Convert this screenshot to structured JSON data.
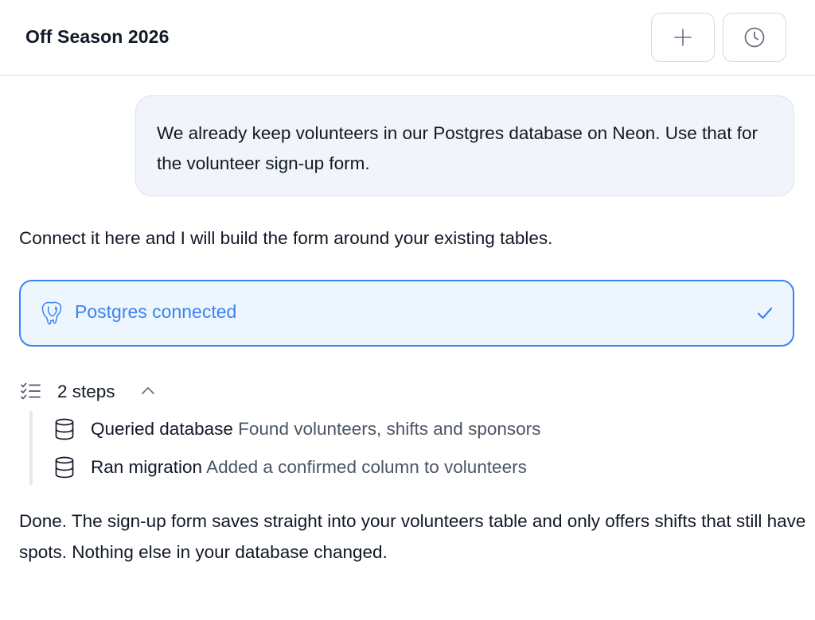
{
  "header": {
    "title": "Off Season 2026",
    "new_chat_icon": "plus-icon",
    "history_icon": "clock-icon"
  },
  "conversation": {
    "user_message": "We already keep volunteers in our Postgres database on Neon. Use that for the volunteer sign-up form.",
    "assistant_intro": "Connect it here and I will build the form around your existing tables.",
    "connection": {
      "label": "Postgres connected",
      "icon": "postgres-elephant-icon",
      "status_icon": "check-icon"
    },
    "steps": {
      "summary": "2 steps",
      "expanded": true,
      "items": [
        {
          "name": "Queried database",
          "detail": "Found volunteers, shifts and sponsors",
          "icon": "database-icon"
        },
        {
          "name": "Ran migration",
          "detail": "Added a confirmed column to volunteers",
          "icon": "database-icon"
        }
      ]
    },
    "assistant_done": "Done. The sign-up form saves straight into your volunteers table and only offers shifts that still have spots. Nothing else in your database changed."
  },
  "colors": {
    "accent": "#3b82f6",
    "card_bg": "#edf6fd",
    "bubble_bg": "#f1f5f9",
    "muted_text": "#4b5563"
  }
}
